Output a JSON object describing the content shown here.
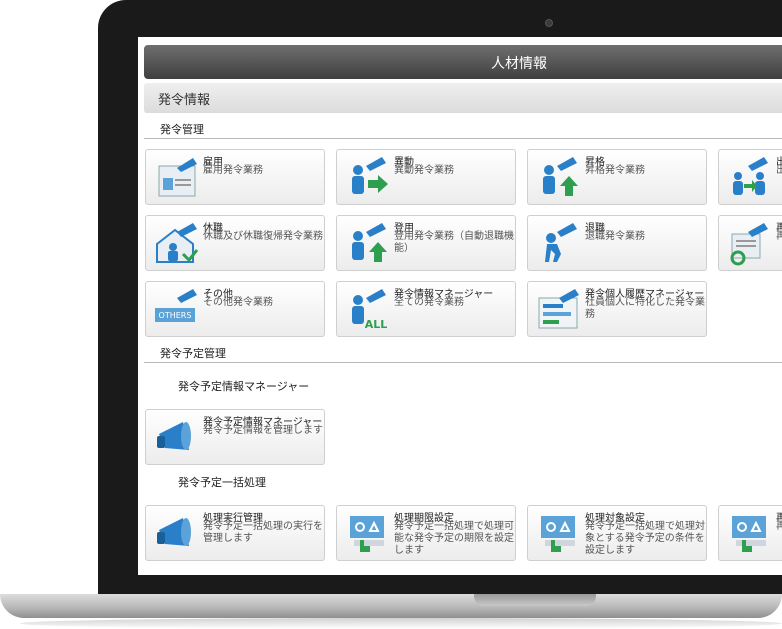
{
  "header": {
    "title": "人材情報"
  },
  "subheader": {
    "title": "発令情報"
  },
  "sections": {
    "hatsurei_kanri": "発令管理",
    "yotei_kanri": "発令予定管理"
  },
  "groups": {
    "yotei_manager": "発令予定情報マネージャー",
    "ikkatsu": "発令予定一括処理"
  },
  "tiles": [
    {
      "title": "雇用",
      "desc": "雇用発令業務",
      "icon": "person-document-icon"
    },
    {
      "title": "異動",
      "desc": "異動発令業務",
      "icon": "person-arrow-right-icon"
    },
    {
      "title": "昇格",
      "desc": "昇格発令業務",
      "icon": "person-arrow-up-icon"
    },
    {
      "title": "出",
      "desc": "出",
      "icon": "people-transfer-icon"
    },
    {
      "title": "休職",
      "desc": "休職及び休職復帰発令業務",
      "icon": "house-person-icon"
    },
    {
      "title": "登用",
      "desc": "登用発令業務（自動退職機能）",
      "icon": "person-arrow-up-icon"
    },
    {
      "title": "退職",
      "desc": "退職発令業務",
      "icon": "person-leaving-icon"
    },
    {
      "title": "再",
      "desc": "再",
      "icon": "document-recycle-icon"
    },
    {
      "title": "その他",
      "desc": "その他発令業務",
      "icon": "others-icon",
      "badge": "OTHERS"
    },
    {
      "title": "発令情報マネージャー",
      "desc": "全ての発令業務",
      "icon": "person-all-icon",
      "badge": "ALL"
    },
    {
      "title": "発令個人履歴マネージャー",
      "desc": "社員個人に特化した発令業務",
      "icon": "history-list-icon"
    },
    {
      "title": "発令予定情報マネージャー",
      "desc": "発令予定情報を管理します",
      "icon": "megaphone-icon"
    },
    {
      "title": "処理実行管理",
      "desc": "発令予定一括処理の実行を管理します",
      "icon": "megaphone-icon"
    },
    {
      "title": "処理期限設定",
      "desc": "発令予定一括処理で処理可能な発令予定の期限を設定します",
      "icon": "settings-hand-icon"
    },
    {
      "title": "処理対象設定",
      "desc": "発令予定一括処理で処理対象とする発令予定の条件を設定します",
      "icon": "settings-hand-icon"
    },
    {
      "title": "再",
      "desc": "再",
      "icon": "settings-hand-icon"
    }
  ],
  "colors": {
    "accent": "#2a7fc9",
    "green": "#2e9e4f",
    "titlebar": "#555555"
  }
}
